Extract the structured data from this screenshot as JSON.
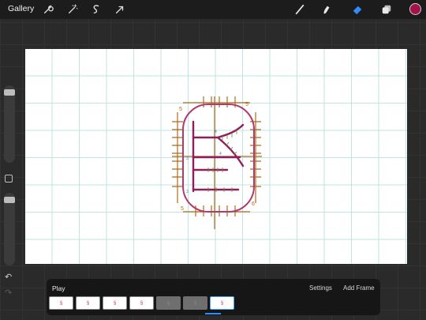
{
  "topbar": {
    "gallery_label": "Gallery",
    "tool_icons": [
      "wrench-icon",
      "magic-wand-icon",
      "selection-icon",
      "transform-arrow-icon"
    ],
    "right_icons": [
      "brush-icon",
      "smudge-icon",
      "eraser-icon",
      "layers-icon"
    ],
    "color": "#a3124a",
    "active_tool": "eraser"
  },
  "animation": {
    "play_label": "Play",
    "settings_label": "Settings",
    "add_frame_label": "Add Frame",
    "frames": [
      {
        "mark": "§",
        "state": "normal"
      },
      {
        "mark": "§",
        "state": "normal"
      },
      {
        "mark": "§",
        "state": "normal"
      },
      {
        "mark": "§",
        "state": "normal"
      },
      {
        "mark": "§",
        "state": "dim"
      },
      {
        "mark": "§",
        "state": "dim"
      },
      {
        "mark": "§",
        "state": "current"
      }
    ]
  },
  "sidebar": {
    "undo_icon": "undo-icon",
    "redo_icon": "redo-icon"
  },
  "drawing": {
    "corner_numbers": [
      "5",
      "5",
      "5",
      "6"
    ],
    "colors": {
      "outline": "#b03a6e",
      "stroke": "#8e1f5a",
      "tick": "#b06a1a",
      "accent": "#3a7acc"
    }
  }
}
